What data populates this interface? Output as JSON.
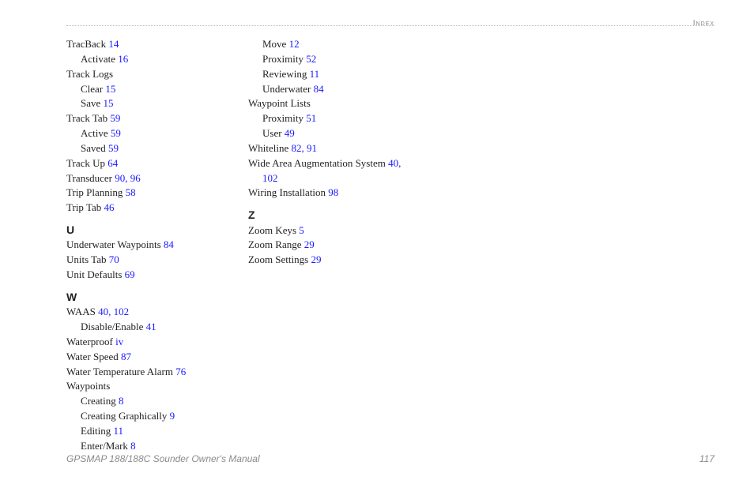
{
  "header": {
    "section": "Index"
  },
  "footer": {
    "title": "GPSMAP 188/188C Sounder Owner's Manual",
    "page": "117"
  },
  "columns": [
    {
      "blocks": [
        {
          "entries": [
            {
              "term": "TracBack",
              "pages": [
                "14"
              ]
            },
            {
              "term": "Activate",
              "pages": [
                "16"
              ],
              "indent": 1
            },
            {
              "term": "Track Logs",
              "pages": []
            },
            {
              "term": "Clear",
              "pages": [
                "15"
              ],
              "indent": 1
            },
            {
              "term": "Save",
              "pages": [
                "15"
              ],
              "indent": 1
            },
            {
              "term": "Track Tab",
              "pages": [
                "59"
              ]
            },
            {
              "term": "Active",
              "pages": [
                "59"
              ],
              "indent": 1
            },
            {
              "term": "Saved",
              "pages": [
                "59"
              ],
              "indent": 1
            },
            {
              "term": "Track Up",
              "pages": [
                "64"
              ]
            },
            {
              "term": "Transducer",
              "pages": [
                "90",
                "96"
              ]
            },
            {
              "term": "Trip Planning",
              "pages": [
                "58"
              ]
            },
            {
              "term": "Trip Tab",
              "pages": [
                "46"
              ]
            }
          ]
        },
        {
          "letter": "U",
          "entries": [
            {
              "term": "Underwater Waypoints",
              "pages": [
                "84"
              ]
            },
            {
              "term": "Units Tab",
              "pages": [
                "70"
              ]
            },
            {
              "term": "Unit Defaults",
              "pages": [
                "69"
              ]
            }
          ]
        },
        {
          "letter": "W",
          "entries": [
            {
              "term": "WAAS",
              "pages": [
                "40",
                "102"
              ]
            },
            {
              "term": "Disable/Enable",
              "pages": [
                "41"
              ],
              "indent": 1
            },
            {
              "term": "Waterproof",
              "pages": [
                "iv"
              ]
            },
            {
              "term": "Water Speed",
              "pages": [
                "87"
              ]
            },
            {
              "term": "Water Temperature Alarm",
              "pages": [
                "76"
              ]
            },
            {
              "term": "Waypoints",
              "pages": []
            },
            {
              "term": "Creating",
              "pages": [
                "8"
              ],
              "indent": 1
            },
            {
              "term": "Creating Graphically",
              "pages": [
                "9"
              ],
              "indent": 1
            },
            {
              "term": "Editing",
              "pages": [
                "11"
              ],
              "indent": 1
            },
            {
              "term": "Enter/Mark",
              "pages": [
                "8"
              ],
              "indent": 1
            }
          ]
        }
      ]
    },
    {
      "blocks": [
        {
          "entries": [
            {
              "term": "Move",
              "pages": [
                "12"
              ],
              "indent": 1
            },
            {
              "term": "Proximity",
              "pages": [
                "52"
              ],
              "indent": 1
            },
            {
              "term": "Reviewing",
              "pages": [
                "11"
              ],
              "indent": 1
            },
            {
              "term": "Underwater",
              "pages": [
                "84"
              ],
              "indent": 1
            },
            {
              "term": "Waypoint Lists",
              "pages": []
            },
            {
              "term": "Proximity",
              "pages": [
                "51"
              ],
              "indent": 1
            },
            {
              "term": "User",
              "pages": [
                "49"
              ],
              "indent": 1
            },
            {
              "term": "Whiteline",
              "pages": [
                "82",
                "91"
              ]
            },
            {
              "term": "Wide Area Augmentation System",
              "pages": [
                "40"
              ],
              "trailingComma": true
            },
            {
              "contPages": [
                "102"
              ],
              "indent": 1
            },
            {
              "term": "Wiring Installation",
              "pages": [
                "98"
              ]
            }
          ]
        },
        {
          "letter": "Z",
          "entries": [
            {
              "term": "Zoom Keys",
              "pages": [
                "5"
              ]
            },
            {
              "term": "Zoom Range",
              "pages": [
                "29"
              ]
            },
            {
              "term": "Zoom Settings",
              "pages": [
                "29"
              ]
            }
          ]
        }
      ]
    }
  ]
}
